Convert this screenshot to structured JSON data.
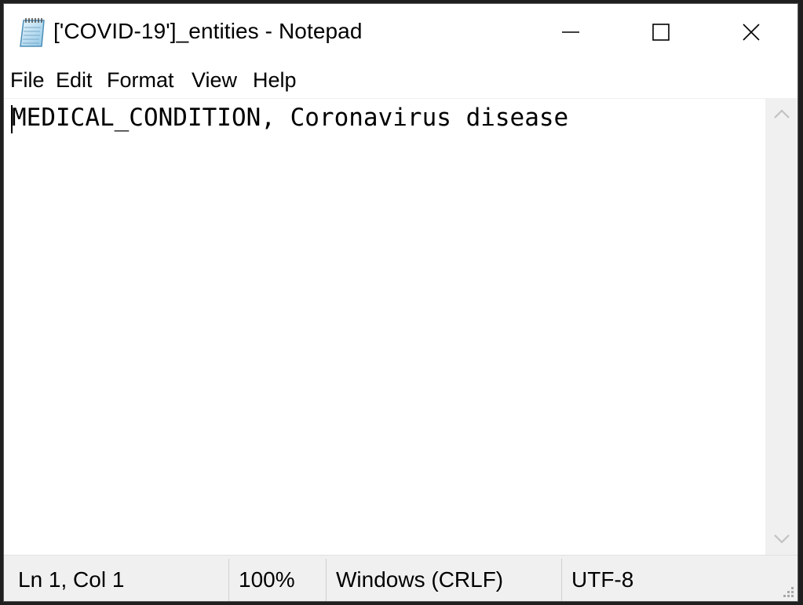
{
  "window": {
    "title": "['COVID-19']_entities - Notepad",
    "app_icon": "notepad-icon"
  },
  "caption_buttons": {
    "minimize_icon": "minimize-icon",
    "maximize_icon": "maximize-icon",
    "close_icon": "close-icon"
  },
  "menu": {
    "items": [
      {
        "label": "File"
      },
      {
        "label": "Edit"
      },
      {
        "label": "Format"
      },
      {
        "label": "View"
      },
      {
        "label": "Help"
      }
    ]
  },
  "editor": {
    "content": "MEDICAL_CONDITION, Coronavirus disease"
  },
  "scrollbar": {
    "up_icon": "chevron-up-icon",
    "down_icon": "chevron-down-icon"
  },
  "status": {
    "position": "Ln 1, Col 1",
    "zoom": "100%",
    "line_ending": "Windows (CRLF)",
    "encoding": "UTF-8"
  },
  "colors": {
    "window_bg": "#ffffff",
    "chrome_bg": "#f0f0f0",
    "text": "#000000"
  }
}
